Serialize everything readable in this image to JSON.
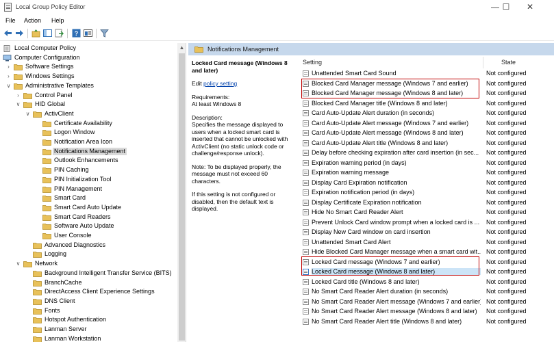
{
  "window": {
    "title": "Local Group Policy Editor",
    "controls": [
      "—",
      "☐",
      "✕"
    ]
  },
  "menu": [
    "File",
    "Action",
    "Help"
  ],
  "tree": [
    {
      "label": "Local Computer Policy",
      "level": 0,
      "expander": "",
      "icon": "policy"
    },
    {
      "label": "Computer Configuration",
      "level": 0,
      "expander": "expanded",
      "icon": "computer"
    },
    {
      "label": "Software Settings",
      "level": 1,
      "expander": "collapsed",
      "icon": "folder"
    },
    {
      "label": "Windows Settings",
      "level": 1,
      "expander": "collapsed",
      "icon": "folder"
    },
    {
      "label": "Administrative Templates",
      "level": 1,
      "expander": "expanded",
      "icon": "folder"
    },
    {
      "label": "Control Panel",
      "level": 2,
      "expander": "collapsed",
      "icon": "folder"
    },
    {
      "label": "HID Global",
      "level": 2,
      "expander": "expanded",
      "icon": "folder"
    },
    {
      "label": "ActivClient",
      "level": 3,
      "expander": "expanded",
      "icon": "folder"
    },
    {
      "label": "Certificate Availability",
      "level": 4,
      "expander": "",
      "icon": "folder"
    },
    {
      "label": "Logon Window",
      "level": 4,
      "expander": "",
      "icon": "folder"
    },
    {
      "label": "Notification Area Icon",
      "level": 4,
      "expander": "",
      "icon": "folder"
    },
    {
      "label": "Notifications Management",
      "level": 4,
      "expander": "",
      "icon": "folder",
      "selected": true
    },
    {
      "label": "Outlook Enhancements",
      "level": 4,
      "expander": "",
      "icon": "folder"
    },
    {
      "label": "PIN Caching",
      "level": 4,
      "expander": "",
      "icon": "folder"
    },
    {
      "label": "PIN Initialization Tool",
      "level": 4,
      "expander": "",
      "icon": "folder"
    },
    {
      "label": "PIN Management",
      "level": 4,
      "expander": "",
      "icon": "folder"
    },
    {
      "label": "Smart Card",
      "level": 4,
      "expander": "",
      "icon": "folder"
    },
    {
      "label": "Smart Card Auto Update",
      "level": 4,
      "expander": "",
      "icon": "folder"
    },
    {
      "label": "Smart Card Readers",
      "level": 4,
      "expander": "",
      "icon": "folder"
    },
    {
      "label": "Software Auto Update",
      "level": 4,
      "expander": "",
      "icon": "folder"
    },
    {
      "label": "User Console",
      "level": 4,
      "expander": "",
      "icon": "folder"
    },
    {
      "label": "Advanced Diagnostics",
      "level": 3,
      "expander": "",
      "icon": "folder"
    },
    {
      "label": "Logging",
      "level": 3,
      "expander": "",
      "icon": "folder"
    },
    {
      "label": "Network",
      "level": 2,
      "expander": "expanded",
      "icon": "folder"
    },
    {
      "label": "Background Intelligent Transfer Service (BITS)",
      "level": 3,
      "expander": "",
      "icon": "folder"
    },
    {
      "label": "BranchCache",
      "level": 3,
      "expander": "",
      "icon": "folder"
    },
    {
      "label": "DirectAccess Client Experience Settings",
      "level": 3,
      "expander": "",
      "icon": "folder"
    },
    {
      "label": "DNS Client",
      "level": 3,
      "expander": "",
      "icon": "folder"
    },
    {
      "label": "Fonts",
      "level": 3,
      "expander": "",
      "icon": "folder"
    },
    {
      "label": "Hotspot Authentication",
      "level": 3,
      "expander": "",
      "icon": "folder"
    },
    {
      "label": "Lanman Server",
      "level": 3,
      "expander": "",
      "icon": "folder"
    },
    {
      "label": "Lanman Workstation",
      "level": 3,
      "expander": "",
      "icon": "folder"
    }
  ],
  "right": {
    "header": "Notifications Management",
    "description": {
      "title": "Locked Card message (Windows 8 and later)",
      "edit_prefix": "Edit",
      "edit_link": "policy setting",
      "requirements_label": "Requirements:",
      "requirements_value": "At least Windows 8",
      "description_label": "Description:",
      "description_text": "Specifies the message displayed to users when a locked smart card is inserted that cannot be unlocked with ActivClient (no static unlock code or challenge/response unlock).",
      "note": "Note: To be displayed properly, the message must not exceed 60 characters.",
      "default_note": "If this setting is not configured or disabled, then the default text is displayed."
    },
    "columns": {
      "setting": "Setting",
      "state": "State"
    },
    "settings": [
      {
        "name": "Unattended Smart Card Sound",
        "state": "Not configured"
      },
      {
        "name": "Blocked Card Manager message (Windows 7 and earlier)",
        "state": "Not configured"
      },
      {
        "name": "Blocked Card Manager message (Windows 8 and later)",
        "state": "Not configured"
      },
      {
        "name": "Blocked Card Manager title (Windows 8 and later)",
        "state": "Not configured"
      },
      {
        "name": "Card Auto-Update Alert duration (in seconds)",
        "state": "Not configured"
      },
      {
        "name": "Card Auto-Update Alert message (Windows 7 and earlier)",
        "state": "Not configured"
      },
      {
        "name": "Card Auto-Update Alert message (Windows 8 and later)",
        "state": "Not configured"
      },
      {
        "name": "Card Auto-Update Alert title (Windows 8 and later)",
        "state": "Not configured"
      },
      {
        "name": "Delay before checking expiration after card insertion (in sec...",
        "state": "Not configured"
      },
      {
        "name": "Expiration warning period (in days)",
        "state": "Not configured"
      },
      {
        "name": "Expiration warning message",
        "state": "Not configured"
      },
      {
        "name": "Display Card Expiration notification",
        "state": "Not configured"
      },
      {
        "name": "Expiration notification period (in days)",
        "state": "Not configured"
      },
      {
        "name": "Display Certificate Expiration notification",
        "state": "Not configured"
      },
      {
        "name": "Hide No Smart Card Reader Alert",
        "state": "Not configured"
      },
      {
        "name": "Prevent Unlock Card window prompt when a locked card is ...",
        "state": "Not configured"
      },
      {
        "name": "Display New Card window on card insertion",
        "state": "Not configured"
      },
      {
        "name": "Unattended Smart Card Alert",
        "state": "Not configured"
      },
      {
        "name": "Hide Blocked Card Manager message when a smart card wit...",
        "state": "Not configured"
      },
      {
        "name": "Locked Card message (Windows 7 and earlier)",
        "state": "Not configured"
      },
      {
        "name": "Locked Card message (Windows 8 and later)",
        "state": "Not configured",
        "selected": true
      },
      {
        "name": "Locked Card title (Windows 8 and later)",
        "state": "Not configured"
      },
      {
        "name": "No Smart Card Reader Alert duration (in seconds)",
        "state": "Not configured"
      },
      {
        "name": "No Smart Card Reader Alert message (Windows 7 and earlier)",
        "state": "Not configured"
      },
      {
        "name": "No Smart Card Reader Alert message (Windows 8 and later)",
        "state": "Not configured"
      },
      {
        "name": "No Smart Card Reader Alert title (Windows 8 and later)",
        "state": "Not configured"
      }
    ]
  },
  "colors": {
    "header_band": "#c6d8ec",
    "highlight_box": "#c00000",
    "selection": "#cce4f7",
    "folder": "#e8c15a",
    "link": "#0645ad"
  }
}
